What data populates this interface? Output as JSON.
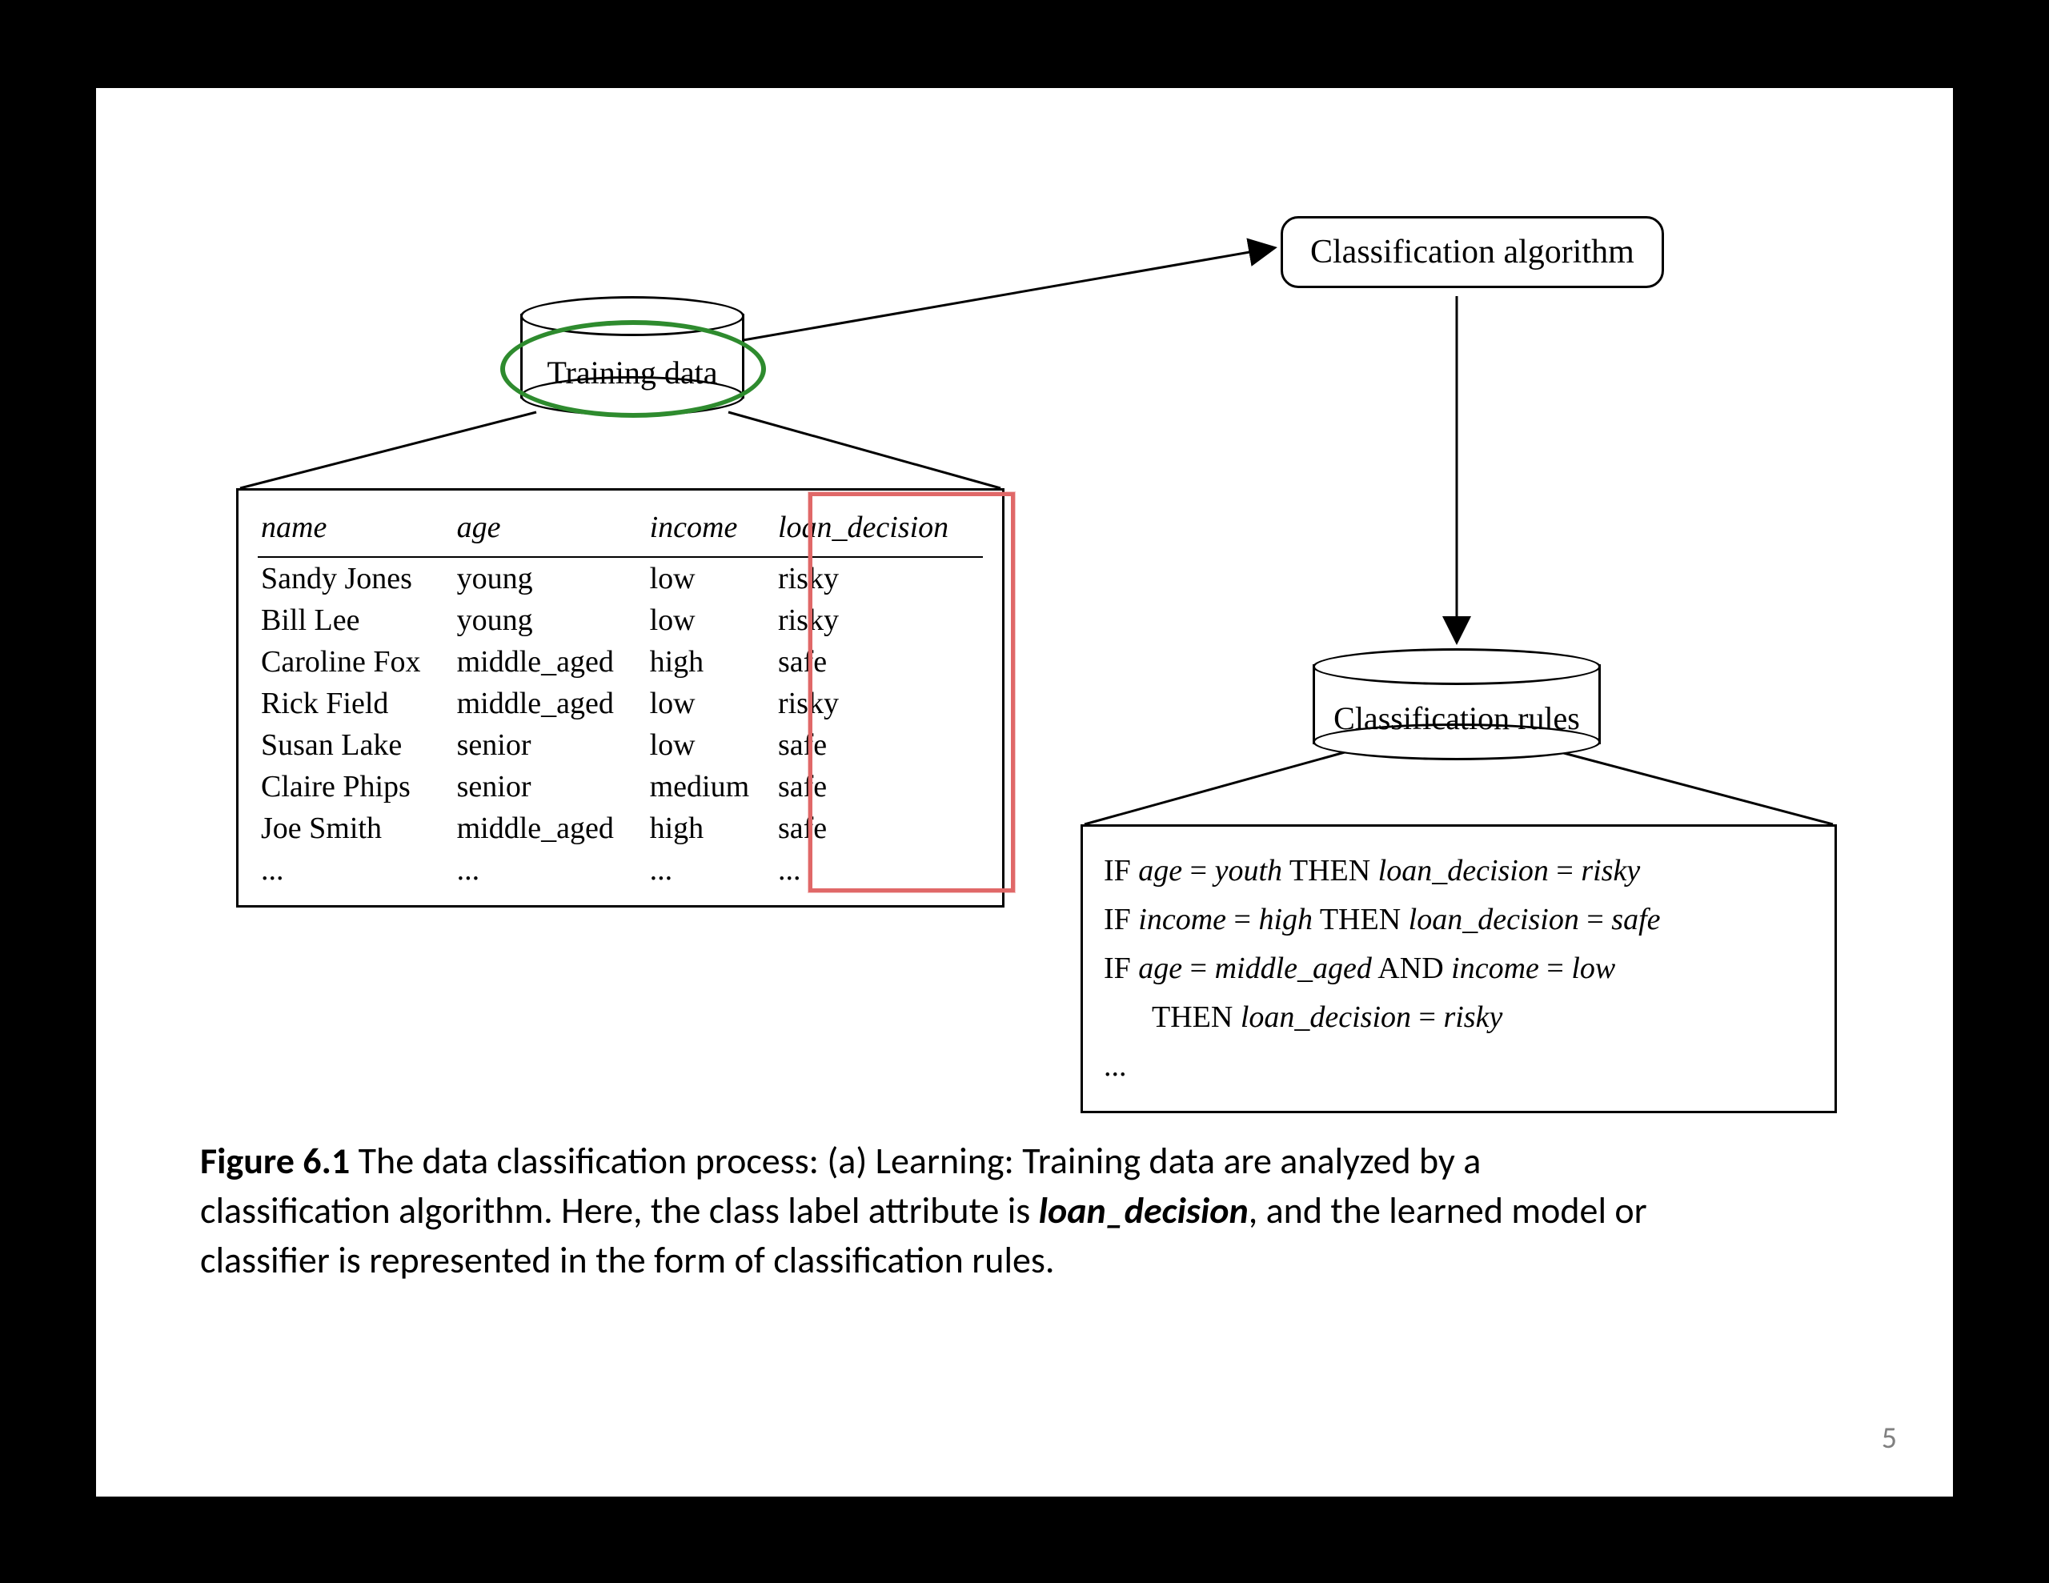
{
  "labels": {
    "training_data": "Training data",
    "classification_algorithm": "Classification algorithm",
    "classification_rules": "Classification rules"
  },
  "training_table": {
    "headers": [
      "name",
      "age",
      "income",
      "loan_decision"
    ],
    "rows": [
      [
        "Sandy Jones",
        "young",
        "low",
        "risky"
      ],
      [
        "Bill Lee",
        "young",
        "low",
        "risky"
      ],
      [
        "Caroline Fox",
        "middle_aged",
        "high",
        "safe"
      ],
      [
        "Rick Field",
        "middle_aged",
        "low",
        "risky"
      ],
      [
        "Susan Lake",
        "senior",
        "low",
        "safe"
      ],
      [
        "Claire Phips",
        "senior",
        "medium",
        "safe"
      ],
      [
        "Joe Smith",
        "middle_aged",
        "high",
        "safe"
      ],
      [
        "...",
        "...",
        "...",
        "..."
      ]
    ],
    "highlight_column": "loan_decision"
  },
  "rules": {
    "r1": {
      "if_attr": "age",
      "if_val": "youth",
      "then_attr": "loan_decision",
      "then_val": "risky"
    },
    "r2": {
      "if_attr": "income",
      "if_val": "high",
      "then_attr": "loan_decision",
      "then_val": "safe"
    },
    "r3": {
      "if1_attr": "age",
      "if1_val": "middle_aged",
      "and_attr": "income",
      "and_val": "low",
      "then_attr": "loan_decision",
      "then_val": "risky"
    },
    "ellipsis": "..."
  },
  "caption": {
    "figure_label": "Figure 6.1",
    "text_before_kw": "  The data classification process: (a) Learning: Training data are analyzed by a classification algorithm. Here, the class label attribute is ",
    "keyword": "loan_decision",
    "text_after_kw": ", and the learned model or classifier is represented in the form of classification rules."
  },
  "page_number": "5"
}
